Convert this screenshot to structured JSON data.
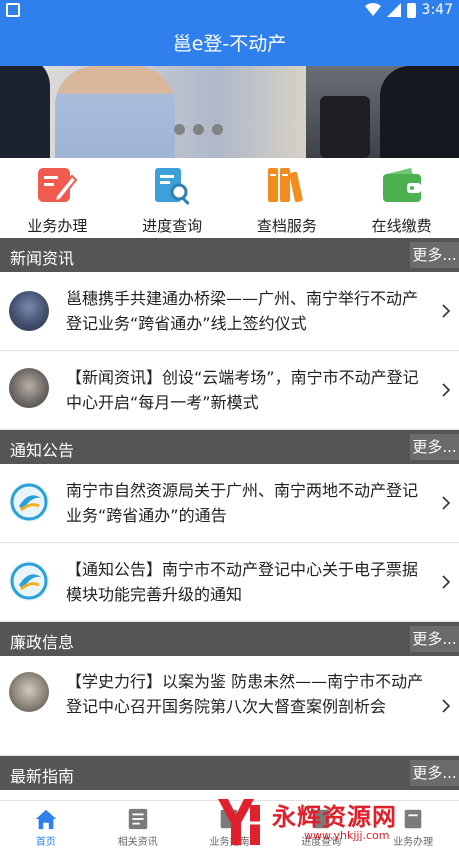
{
  "statusbar": {
    "time": "3:47"
  },
  "appbar": {
    "title": "邕e登-不动产"
  },
  "quick_actions": [
    {
      "label": "业务办理",
      "icon": "edit-icon",
      "color": "#f05a4f"
    },
    {
      "label": "进度查询",
      "icon": "search-doc-icon",
      "color": "#3ea0d8"
    },
    {
      "label": "查档服务",
      "icon": "archive-icon",
      "color": "#f28c1e"
    },
    {
      "label": "在线缴费",
      "icon": "wallet-icon",
      "color": "#4caf50"
    }
  ],
  "sections": {
    "news": {
      "title": "新闻资讯",
      "more": "更多...",
      "items": [
        {
          "text": "邕穗携手共建通办桥梁——广州、南宁举行不动产登记业务“跨省通办”线上签约仪式"
        },
        {
          "text": "【新闻资讯】创设“云端考场”，南宁市不动产登记中心开启“每月一考”新模式"
        }
      ]
    },
    "notice": {
      "title": "通知公告",
      "more": "更多...",
      "items": [
        {
          "text": "南宁市自然资源局关于广州、南宁两地不动产登记业务“跨省通办”的通告"
        },
        {
          "text": "【通知公告】南宁市不动产登记中心关于电子票据模块功能完善升级的通知"
        }
      ]
    },
    "integrity": {
      "title": "廉政信息",
      "more": "更多...",
      "items": [
        {
          "text": "【学史力行】以案为鉴 防患未然——南宁市不动产登记中心召开国务院第八次大督查案例剖析会"
        }
      ]
    },
    "guide": {
      "title": "最新指南",
      "more": "更多..."
    }
  },
  "tabbar": [
    {
      "label": "首页",
      "icon": "home-icon",
      "active": true
    },
    {
      "label": "相关资讯",
      "icon": "news-icon",
      "active": false
    },
    {
      "label": "业务指南",
      "icon": "guide-icon",
      "active": false
    },
    {
      "label": "进度查询",
      "icon": "progress-icon",
      "active": false
    },
    {
      "label": "业务办理",
      "icon": "business-icon",
      "active": false
    }
  ],
  "watermark": {
    "text": "永辉资源网",
    "url": "www.yhkjjj.com"
  }
}
